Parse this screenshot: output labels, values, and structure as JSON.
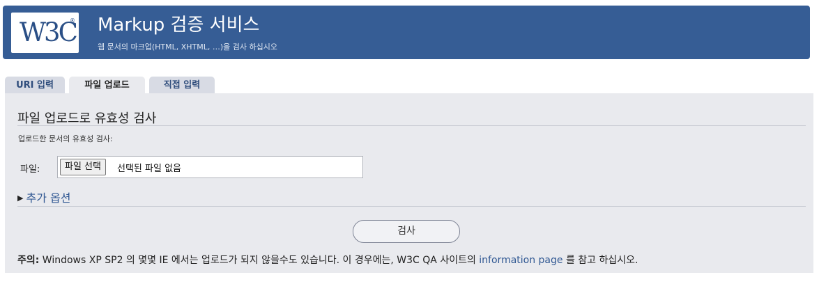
{
  "header": {
    "logo_text": "W3C",
    "logo_reg": "®",
    "title": "Markup 검증 서비스",
    "subtitle": "웹 문서의 마크업(HTML, XHTML, …)을 검사 하십시오"
  },
  "tabs": [
    {
      "label": "URI 입력",
      "active": false
    },
    {
      "label": "파일 업로드",
      "active": true
    },
    {
      "label": "직접 입력",
      "active": false
    }
  ],
  "panel": {
    "heading": "파일 업로드로 유효성 검사",
    "description": "업로드한 문서의 유효성 검사:",
    "file_label": "파일:",
    "file_button": "파일 선택",
    "file_status": "선택된 파일 없음",
    "more_options": "추가 옵션",
    "submit": "검사"
  },
  "note": {
    "prefix": "주의:",
    "text": " Windows XP SP2 의 몇몇 IE 에서는 업로드가 되지 않을수도 있습니다. 이 경우에는, W3C QA 사이트의 ",
    "link": "information page",
    "suffix": " 를 참고 하십시오."
  },
  "colors": {
    "banner": "#365d95",
    "panel": "#e9eaee",
    "link": "#2f5792"
  }
}
